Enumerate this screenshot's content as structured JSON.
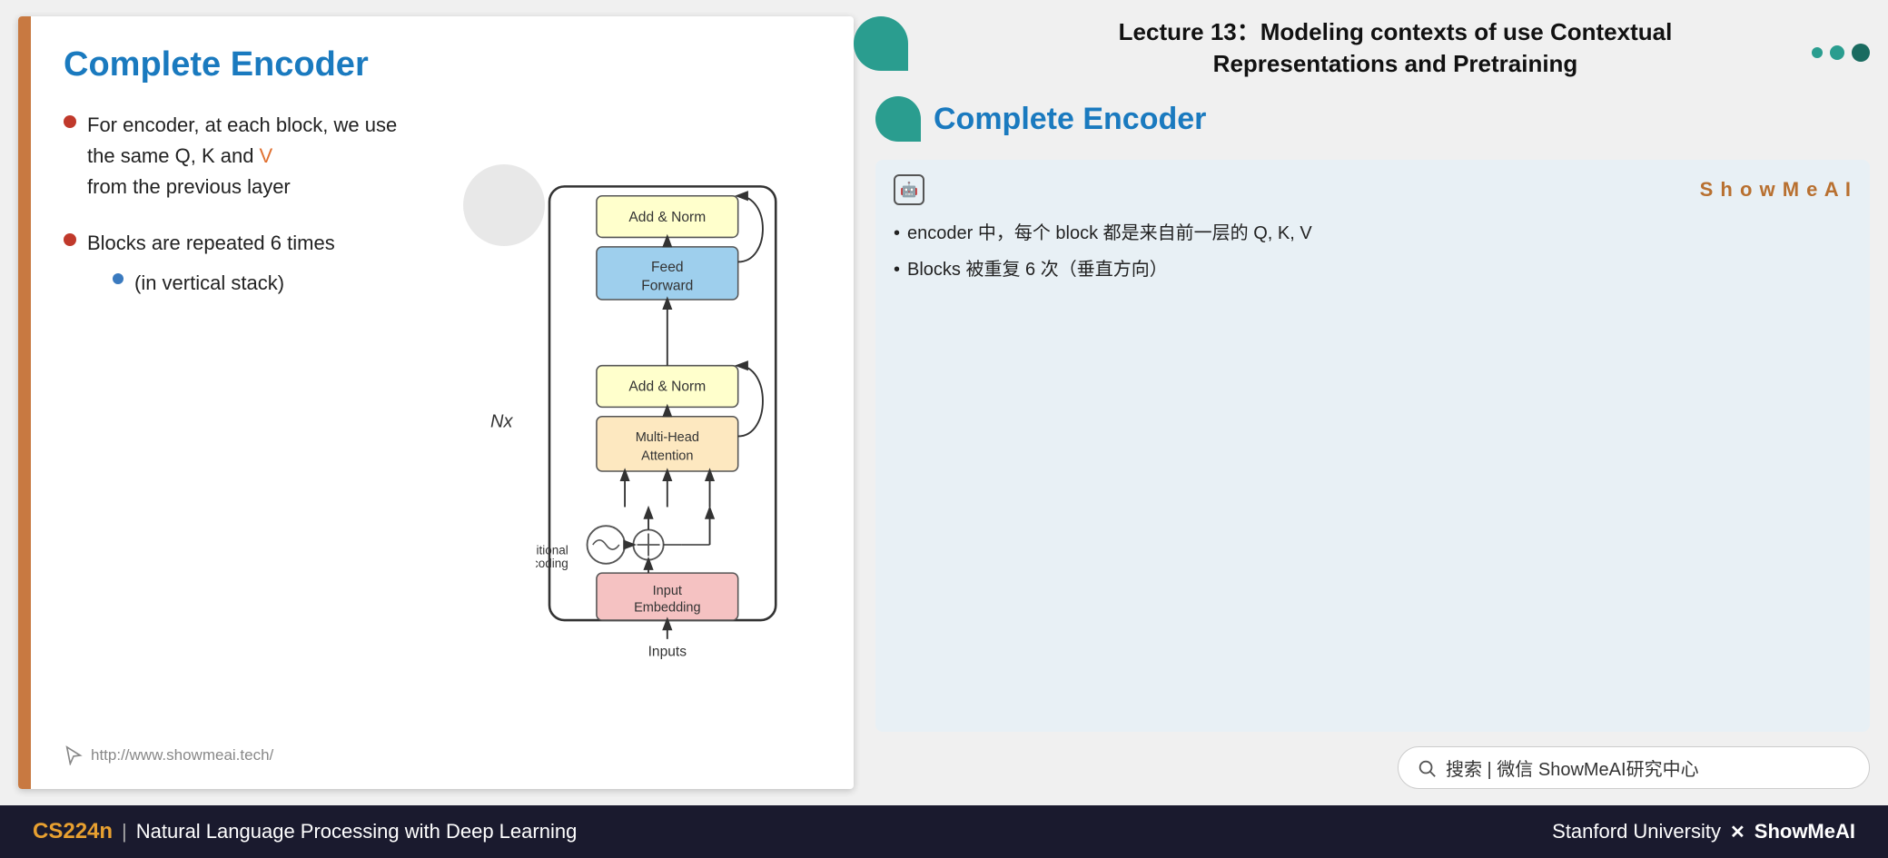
{
  "slide": {
    "title": "Complete Encoder",
    "bullet1": {
      "text_before": "For encoder, at each block, we use the same Q, K and ",
      "highlight": "V",
      "text_after": " from the previous layer"
    },
    "bullet2": "Blocks are repeated 6 times",
    "sub_bullet": "(in vertical stack)",
    "nx_label": "Nx",
    "footer_url": "http://www.showmeai.tech/"
  },
  "diagram": {
    "add_norm_top": "Add & Norm",
    "feed_forward": "Feed\nForward",
    "add_norm_bottom": "Add & Norm",
    "multi_head": "Multi-Head\nAttention",
    "positional_encoding": "Positional\nEncoding",
    "input_embedding": "Input\nEmbedding",
    "inputs": "Inputs"
  },
  "right_panel": {
    "lecture_title_line1": "Lecture 13：Modeling contexts of use Contextual",
    "lecture_title_line2": "Representations and Pretraining",
    "encoder_title": "Complete Encoder",
    "showmeai_brand": "S h o w M e A I",
    "bullet1": "encoder 中，每个 block 都是来自前一层的 Q, K, V",
    "bullet2": "Blocks 被重复 6 次（垂直方向）",
    "search_text": "搜索 | 微信  ShowMeAI研究中心"
  },
  "bottom_bar": {
    "course_code": "CS224n",
    "separator": "|",
    "course_name": "Natural Language Processing with Deep Learning",
    "university": "Stanford University",
    "x_mark": "✕",
    "showmeai": "ShowMeAI"
  }
}
